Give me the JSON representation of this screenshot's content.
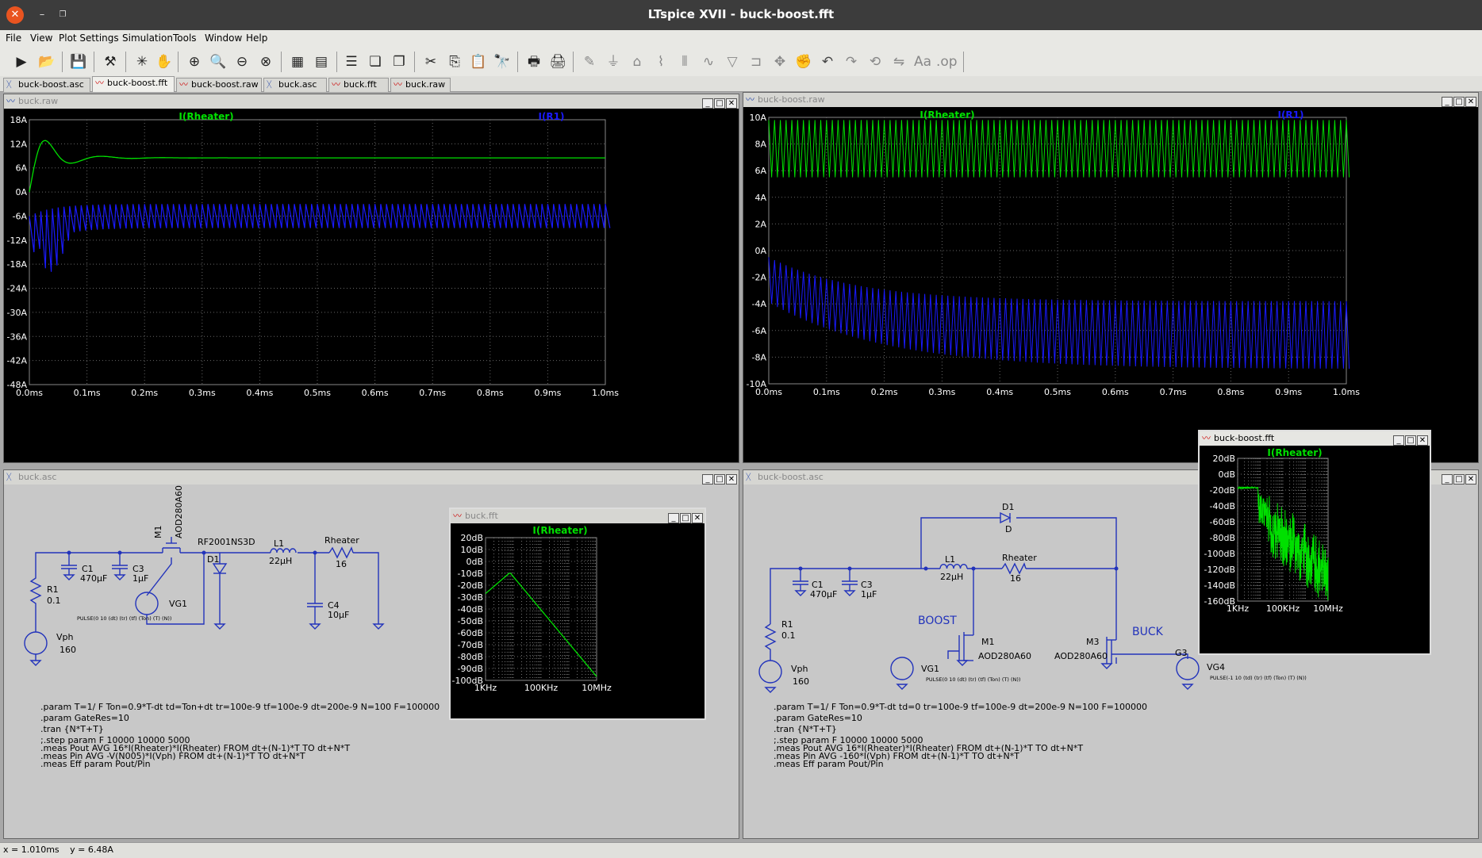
{
  "titlebar": {
    "title": "LTspice XVII - buck-boost.fft"
  },
  "menu": [
    "File",
    "View",
    "Plot Settings",
    "Simulation",
    "Tools",
    "Window",
    "Help"
  ],
  "tabs": [
    {
      "label": "buck-boost.asc",
      "icon": "schematic-icon"
    },
    {
      "label": "buck-boost.fft",
      "icon": "waveform-icon"
    },
    {
      "label": "buck-boost.raw",
      "icon": "waveform-icon"
    },
    {
      "label": "buck.asc",
      "icon": "schematic-icon"
    },
    {
      "label": "buck.fft",
      "icon": "waveform-icon"
    },
    {
      "label": "buck.raw",
      "icon": "waveform-icon"
    }
  ],
  "windows": {
    "buck_raw": {
      "title": "buck.raw",
      "trace1": "I(Rheater)",
      "trace2": "I(R1)",
      "yticks": [
        "18A",
        "12A",
        "6A",
        "0A",
        "-6A",
        "-12A",
        "-18A",
        "-24A",
        "-30A",
        "-36A",
        "-42A",
        "-48A"
      ],
      "xticks": [
        "0.0ms",
        "0.1ms",
        "0.2ms",
        "0.3ms",
        "0.4ms",
        "0.5ms",
        "0.6ms",
        "0.7ms",
        "0.8ms",
        "0.9ms",
        "1.0ms"
      ]
    },
    "buckboost_raw": {
      "title": "buck-boost.raw",
      "trace1": "I(Rheater)",
      "trace2": "I(R1)",
      "yticks": [
        "10A",
        "8A",
        "6A",
        "4A",
        "2A",
        "0A",
        "-2A",
        "-4A",
        "-6A",
        "-8A",
        "-10A"
      ],
      "xticks": [
        "0.0ms",
        "0.1ms",
        "0.2ms",
        "0.3ms",
        "0.4ms",
        "0.5ms",
        "0.6ms",
        "0.7ms",
        "0.8ms",
        "0.9ms",
        "1.0ms"
      ]
    },
    "buck_asc": {
      "title": "buck.asc",
      "labels": {
        "m1": "M1",
        "m1part": "AOD280A60",
        "d1part": "RF2001NS3D",
        "d1": "D1",
        "l1": "L1",
        "l1val": "22µH",
        "rheater": "Rheater",
        "rheaterval": "16",
        "c1": "C1",
        "c1val": "470µF",
        "c3": "C3",
        "c3val": "1µF",
        "c4": "C4",
        "c4val": "10µF",
        "r1": "R1",
        "r1val": "0.1",
        "vg1": "VG1",
        "vph": "Vph",
        "vphval": "160",
        "pulse": "PULSE(0 10 (dt) (tr) (tf) (Ton) (T) (N))"
      },
      "directives": [
        ".param T=1/ F Ton=0.9*T-dt td=Ton+dt tr=100e-9 tf=100e-9 dt=200e-9 N=100 F=100000",
        ".param GateRes=10",
        ".tran {N*T+T}",
        ";.step param F 10000 10000 5000",
        ".meas Pout AVG 16*I(Rheater)*I(Rheater) FROM dt+(N-1)*T TO dt+N*T",
        ".meas Pin AVG -V(N005)*I(Vph) FROM dt+(N-1)*T TO dt+N*T",
        ".meas Eff param Pout/Pin"
      ]
    },
    "buck_fft": {
      "title": "buck.fft",
      "trace": "I(Rheater)",
      "yticks": [
        "20dB",
        "10dB",
        "0dB",
        "-10dB",
        "-20dB",
        "-30dB",
        "-40dB",
        "-50dB",
        "-60dB",
        "-70dB",
        "-80dB",
        "-90dB",
        "-100dB"
      ],
      "xticks": [
        "1KHz",
        "100KHz",
        "10MHz"
      ]
    },
    "buckboost_asc": {
      "title": "buck-boost.asc",
      "labels": {
        "d1": "D1",
        "d1d": "D",
        "l1": "L1",
        "l1val": "22µH",
        "rheater": "Rheater",
        "rheaterval": "16",
        "c1": "C1",
        "c1val": "470µF",
        "c3": "C3",
        "c3val": "1µF",
        "r1": "R1",
        "r1val": "0.1",
        "boost": "BOOST",
        "buck": "BUCK",
        "m1": "M1",
        "m1part": "AOD280A60",
        "m3": "M3",
        "m3part": "AOD280A60",
        "vg1": "VG1",
        "vg4": "VG4",
        "g3": "G3",
        "vph": "Vph",
        "vphval": "160",
        "pulse1": "PULSE(0 10 (dt) (tr) (tf) (Ton) (T) (N))",
        "pulse2": "PULSE(-1 10 (td) (tr) (tf) (Ton) (T) (N))"
      },
      "directives": [
        ".param T=1/ F Ton=0.9*T-dt td=0 tr=100e-9 tf=100e-9 dt=200e-9 N=100 F=100000",
        ".param GateRes=10",
        ".tran {N*T+T}",
        ";.step param F 10000 10000 5000",
        ".meas Pout AVG 16*I(Rheater)*I(Rheater) FROM dt+(N-1)*T TO dt+N*T",
        ".meas Pin AVG -160*I(Vph) FROM dt+(N-1)*T TO dt+N*T",
        ".meas Eff param Pout/Pin"
      ]
    },
    "buckboost_fft": {
      "title": "buck-boost.fft",
      "trace": "I(Rheater)",
      "yticks": [
        "20dB",
        "0dB",
        "-20dB",
        "-40dB",
        "-60dB",
        "-80dB",
        "-100dB",
        "-120dB",
        "-140dB",
        "-160dB"
      ],
      "xticks": [
        "1KHz",
        "100KHz",
        "10MHz"
      ]
    }
  },
  "status": {
    "x": "x = 1.010ms",
    "y": "y = 6.48A"
  },
  "colors": {
    "green": "#00ff00",
    "blue": "#1a1aff",
    "grid": "#777777",
    "wire": "#2233bb"
  }
}
